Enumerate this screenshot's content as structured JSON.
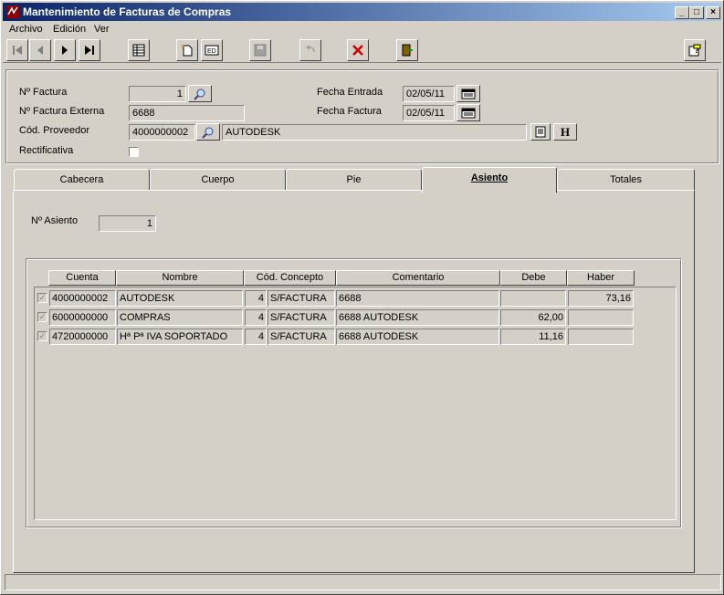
{
  "window": {
    "title": "Mantenimiento de Facturas de Compras"
  },
  "menu": [
    "Archivo",
    "Edición",
    "Ver"
  ],
  "form": {
    "num_factura_label": "Nº Factura",
    "num_factura": "1",
    "num_externa_label": "Nº Factura Externa",
    "num_externa": "6688",
    "proveedor_label": "Cód. Proveedor",
    "proveedor_code": "4000000002",
    "proveedor_name": "AUTODESK",
    "rectificativa_label": "Rectificativa",
    "fecha_entrada_label": "Fecha Entrada",
    "fecha_entrada": "02/05/11",
    "fecha_factura_label": "Fecha Factura",
    "fecha_factura": "02/05/11",
    "h_button": "H"
  },
  "tabs": [
    "Cabecera",
    "Cuerpo",
    "Pie",
    "Asiento",
    "Totales"
  ],
  "active_tab": "Asiento",
  "asiento": {
    "label": "Nº Asiento",
    "value": "1",
    "columns": [
      "Cuenta",
      "Nombre",
      "Cód. Concepto",
      "Comentario",
      "Debe",
      "Haber"
    ],
    "rows": [
      {
        "cuenta": "4000000002",
        "nombre": "AUTODESK",
        "cod": "4",
        "concepto": "S/FACTURA",
        "comentario": "6688",
        "debe": "",
        "haber": "73,16"
      },
      {
        "cuenta": "6000000000",
        "nombre": "COMPRAS",
        "cod": "4",
        "concepto": "S/FACTURA",
        "comentario": "6688 AUTODESK",
        "debe": "62,00",
        "haber": ""
      },
      {
        "cuenta": "4720000000",
        "nombre": "Hª Pª IVA SOPORTADO",
        "cod": "4",
        "concepto": "S/FACTURA",
        "comentario": "6688 AUTODESK",
        "debe": "11,16",
        "haber": ""
      }
    ]
  },
  "colors": {
    "title_start": "#0a246a",
    "title_end": "#a6caf0",
    "face": "#d4d0c8",
    "delete_red": "#cc0000"
  }
}
